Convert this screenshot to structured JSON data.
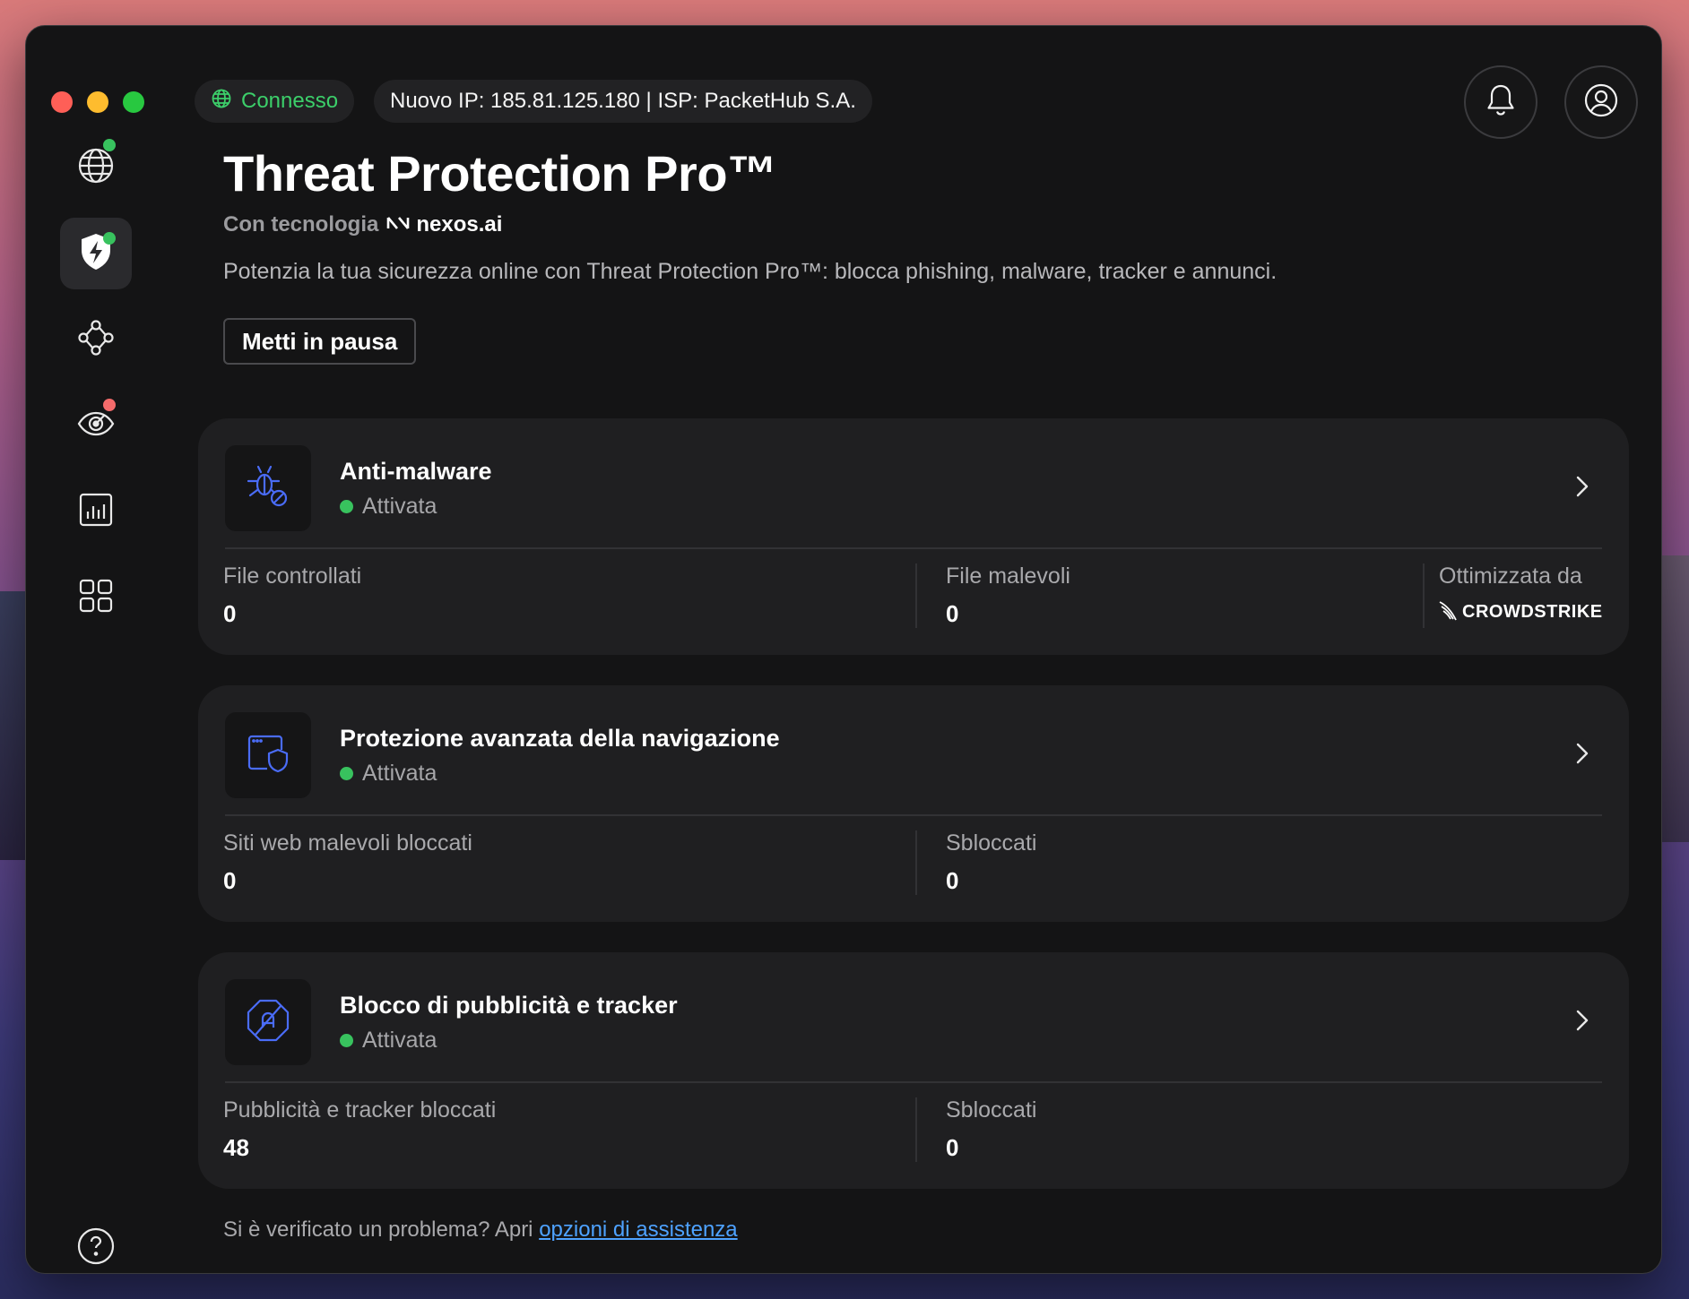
{
  "status": {
    "connected_label": "Connesso",
    "ip_info": "Nuovo IP: 185.81.125.180 | ISP: PacketHub S.A."
  },
  "header": {
    "title": "Threat Protection Pro™",
    "powered_by_label": "Con tecnologia",
    "powered_by_brand": "nexos.ai",
    "description": "Potenzia la tua sicurezza online con Threat Protection Pro™: blocca phishing, malware, tracker e annunci.",
    "pause_button": "Metti in pausa"
  },
  "cards": [
    {
      "title": "Anti-malware",
      "status": "Attivata",
      "stats": [
        {
          "label": "File controllati",
          "value": "0"
        },
        {
          "label": "File malevoli",
          "value": "0"
        }
      ],
      "optimized_label": "Ottimizzata da",
      "optimized_brand": "CROWDSTRIKE"
    },
    {
      "title": "Protezione avanzata della navigazione",
      "status": "Attivata",
      "stats": [
        {
          "label": "Siti web malevoli bloccati",
          "value": "0"
        },
        {
          "label": "Sbloccati",
          "value": "0"
        }
      ]
    },
    {
      "title": "Blocco di pubblicità e tracker",
      "status": "Attivata",
      "stats": [
        {
          "label": "Pubblicità e tracker bloccati",
          "value": "48"
        },
        {
          "label": "Sbloccati",
          "value": "0"
        }
      ]
    }
  ],
  "footer": {
    "text": "Si è verificato un problema? Apri ",
    "link": "opzioni di assistenza"
  },
  "colors": {
    "accent_green": "#38c25e",
    "link_blue": "#4ea2ff",
    "icon_blue": "#4a6cf7",
    "alert_red": "#f46b6b"
  },
  "icons": {
    "sidebar": [
      "globe-icon",
      "shield-bolt-icon",
      "mesh-network-icon",
      "dark-web-monitor-icon",
      "stats-icon",
      "apps-grid-icon",
      "help-icon"
    ],
    "topbar": [
      "bell-icon",
      "user-icon"
    ]
  }
}
